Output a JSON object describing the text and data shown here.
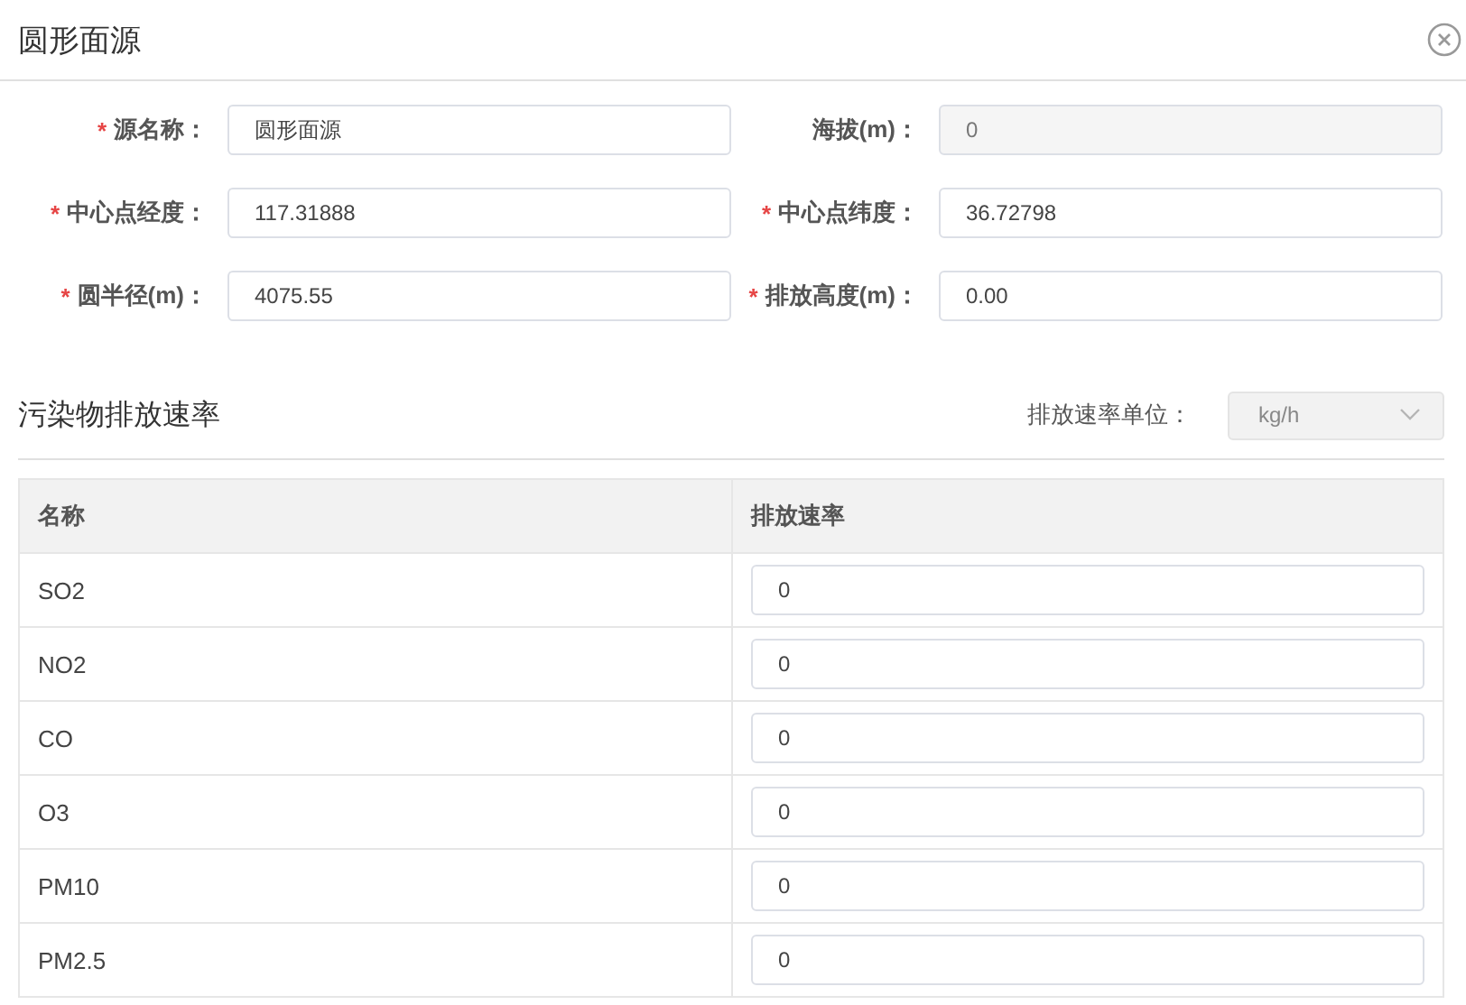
{
  "dialog": {
    "title": "圆形面源"
  },
  "form": [
    {
      "mark": "*",
      "label": "源名称：",
      "value": "圆形面源",
      "disabled": false
    },
    {
      "label": "海拔(m)：",
      "value": "0",
      "disabled": true
    },
    {
      "mark": "*",
      "label": "中心点经度：",
      "value": "117.31888",
      "disabled": false
    },
    {
      "mark": "*",
      "label": "中心点纬度：",
      "value": "36.72798",
      "disabled": false
    },
    {
      "mark": "*",
      "label": "圆半径(m)：",
      "value": "4075.55",
      "disabled": false
    },
    {
      "mark": "*",
      "label": "排放高度(m)：",
      "value": "0.00",
      "disabled": false
    }
  ],
  "section": {
    "title": "污染物排放速率",
    "unit_label": "排放速率单位：",
    "unit_value": "kg/h",
    "unit_disabled": true
  },
  "table": {
    "columns": [
      "名称",
      "排放速率"
    ],
    "rows": [
      {
        "name": "SO2",
        "rate": "0"
      },
      {
        "name": "NO2",
        "rate": "0"
      },
      {
        "name": "CO",
        "rate": "0"
      },
      {
        "name": "O3",
        "rate": "0"
      },
      {
        "name": "PM10",
        "rate": "0"
      },
      {
        "name": "PM2.5",
        "rate": "0"
      }
    ]
  }
}
